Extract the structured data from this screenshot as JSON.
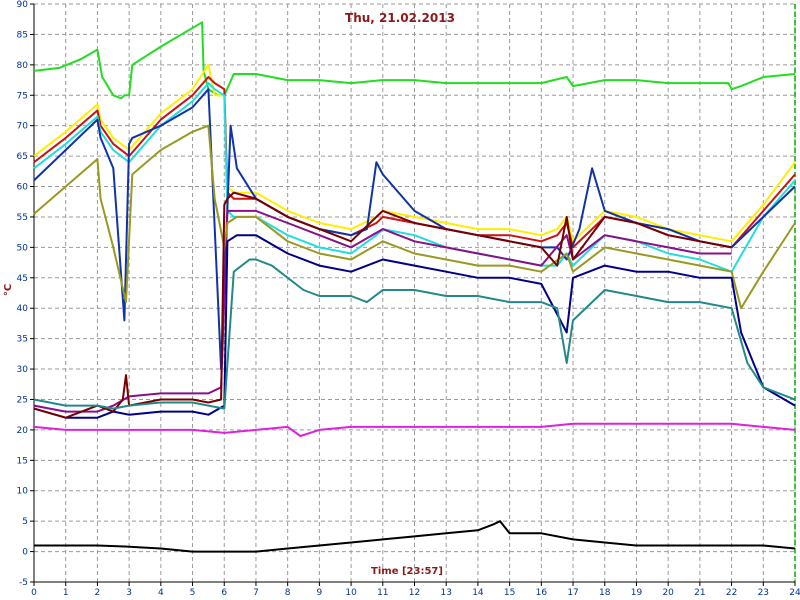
{
  "chart_data": {
    "type": "line",
    "title": "Thu, 21.02.2013",
    "xlabel": "Time [23:57]",
    "ylabel": "°C",
    "xlim": [
      0,
      24
    ],
    "ylim": [
      -5,
      90
    ],
    "x_ticks": [
      "0",
      "1",
      "2",
      "3",
      "4",
      "5",
      "6",
      "7",
      "8",
      "9",
      "10",
      "11",
      "12",
      "13",
      "14",
      "15",
      "16",
      "17",
      "18",
      "19",
      "20",
      "21",
      "22",
      "23",
      "24"
    ],
    "y_ticks": [
      "-5",
      "0",
      "5",
      "10",
      "15",
      "20",
      "25",
      "30",
      "35",
      "40",
      "45",
      "50",
      "55",
      "60",
      "65",
      "70",
      "75",
      "80",
      "85",
      "90"
    ],
    "grid": true,
    "legend": "none",
    "series": [
      {
        "color": "#22dd22",
        "x": [
          0,
          0.8,
          1.5,
          2,
          2.15,
          2.5,
          2.75,
          2.85,
          3,
          3.1,
          4,
          5.3,
          5.35,
          5.5,
          5.8,
          6,
          6.3,
          7,
          8,
          9,
          10,
          11,
          12,
          13,
          14,
          15,
          16,
          16.8,
          17,
          18,
          19,
          20,
          21,
          21.9,
          22,
          22.3,
          23,
          24
        ],
        "y": [
          79,
          79.5,
          81,
          82.5,
          78,
          75,
          74.5,
          75,
          75,
          80,
          83,
          87,
          79,
          76,
          75,
          75,
          78.5,
          78.5,
          77.5,
          77.5,
          77,
          77.5,
          77.5,
          77,
          77,
          77,
          77,
          78,
          76.5,
          77.5,
          77.5,
          77,
          77,
          77,
          76,
          76.5,
          78,
          78.5
        ]
      },
      {
        "color": "#ffee00",
        "x": [
          0,
          1,
          2,
          2.1,
          2.5,
          3,
          4,
          5,
          5.5,
          5.7,
          6,
          6.1,
          6.3,
          7,
          8,
          9,
          10,
          10.8,
          11,
          12,
          13,
          14,
          15,
          16,
          16.5,
          16.8,
          17,
          18,
          19,
          20,
          21,
          22,
          23,
          24
        ],
        "y": [
          65,
          69,
          73.5,
          71,
          68,
          66,
          72,
          76,
          80,
          75,
          75,
          60,
          59,
          59,
          56,
          54,
          53,
          55,
          56,
          55,
          54,
          53,
          53,
          52,
          53,
          55,
          51,
          56,
          55,
          53,
          52,
          51,
          57,
          64
        ]
      },
      {
        "color": "#cc1111",
        "x": [
          0,
          1,
          2,
          2.1,
          2.5,
          3,
          4,
          5,
          5.5,
          5.7,
          6,
          6.1,
          6.3,
          7,
          8,
          9,
          10,
          10.8,
          11,
          12,
          13,
          14,
          15,
          16,
          16.5,
          16.8,
          17,
          18,
          19,
          20,
          21,
          22,
          23,
          24
        ],
        "y": [
          64,
          68,
          72.5,
          70,
          67,
          65,
          71,
          75,
          78,
          77,
          76,
          59,
          58,
          58,
          55,
          53,
          52,
          54,
          55,
          54,
          53,
          52,
          52,
          51,
          52,
          54,
          50,
          55,
          54,
          52,
          51,
          50,
          56,
          62
        ]
      },
      {
        "color": "#22dddd",
        "x": [
          0,
          1,
          2,
          2.1,
          2.5,
          3,
          4,
          5,
          5.5,
          5.7,
          6,
          6.1,
          6.3,
          7,
          8,
          9,
          10,
          10.8,
          11,
          12,
          13,
          14,
          15,
          16,
          16.5,
          16.8,
          17,
          18,
          19,
          20,
          21,
          22,
          23,
          24
        ],
        "y": [
          63,
          67,
          71.5,
          69,
          66,
          64,
          70,
          74,
          77,
          76,
          75,
          56,
          55,
          55,
          52,
          50,
          49,
          52,
          53,
          52,
          50,
          49,
          48,
          47,
          47,
          49,
          47,
          52,
          51,
          49,
          48,
          46,
          55,
          61
        ]
      },
      {
        "color": "#1133aa",
        "x": [
          0,
          1,
          2,
          2.1,
          2.5,
          2.85,
          3,
          3.1,
          4,
          5,
          5.5,
          5.9,
          6.2,
          6.4,
          7,
          8,
          9,
          10,
          10.5,
          10.8,
          11,
          12,
          13,
          14,
          15,
          16,
          16.5,
          16.8,
          17.2,
          17.6,
          18,
          19,
          20,
          21,
          22,
          23,
          24
        ],
        "y": [
          61,
          66,
          71,
          68,
          63,
          38,
          67,
          68,
          70,
          73,
          76,
          30,
          70,
          63,
          58,
          55,
          53,
          52,
          53,
          64,
          62,
          56,
          53,
          52,
          51,
          50,
          50,
          48,
          53,
          63,
          56,
          54,
          53,
          51,
          50,
          55,
          60
        ]
      },
      {
        "color": "#881188",
        "x": [
          0,
          1,
          2,
          2.5,
          3,
          4,
          5,
          5.5,
          5.9,
          6.1,
          6.4,
          7,
          8,
          9,
          10,
          11,
          12,
          13,
          14,
          15,
          16,
          16.8,
          17,
          18,
          19,
          20,
          21,
          22
        ],
        "y": [
          24,
          23,
          23,
          24,
          25.5,
          26,
          26,
          26,
          27,
          56,
          56,
          56,
          54,
          52,
          50,
          53,
          51,
          50,
          49,
          48,
          47,
          52,
          48,
          52,
          51,
          50,
          49,
          49
        ]
      },
      {
        "color": "#999922",
        "x": [
          0,
          1,
          2,
          2.1,
          2.5,
          2.9,
          3.1,
          4,
          5,
          5.5,
          5.7,
          6,
          6.1,
          6.4,
          7,
          8,
          9,
          10,
          11,
          12,
          13,
          14,
          15,
          16,
          16.8,
          17,
          18,
          19,
          20,
          21,
          22,
          22.3,
          23,
          24
        ],
        "y": [
          55.5,
          60,
          64.5,
          58,
          50,
          41,
          62,
          66,
          69,
          70,
          58,
          50,
          54,
          55,
          55,
          51,
          49,
          48,
          51,
          49,
          48,
          47,
          47,
          46,
          49,
          46,
          50,
          49,
          48,
          47,
          46,
          40,
          46,
          54
        ]
      },
      {
        "color": "#000088",
        "x": [
          0,
          1,
          2,
          2.5,
          3,
          4,
          5,
          5.5,
          6,
          6.1,
          6.4,
          7,
          8,
          9,
          10,
          11,
          12,
          13,
          14,
          15,
          16,
          16.8,
          17,
          18,
          19,
          20,
          21,
          22,
          22.3,
          23,
          24
        ],
        "y": [
          23.5,
          22,
          22,
          23,
          22.5,
          23,
          23,
          22.5,
          24,
          51,
          52,
          52,
          49,
          47,
          46,
          48,
          47,
          46,
          45,
          45,
          44,
          36,
          45,
          47,
          46,
          46,
          45,
          45,
          36,
          27,
          24
        ]
      },
      {
        "color": "#770000",
        "x": [
          0,
          1,
          2,
          2.5,
          2.8,
          2.9,
          3,
          4,
          5,
          5.5,
          5.9,
          6,
          6.1,
          6.3,
          7,
          8,
          9,
          10,
          10.8,
          11,
          12,
          13,
          14,
          15,
          16,
          16.5,
          16.8,
          17,
          18,
          19,
          20,
          21,
          22
        ],
        "y": [
          23.5,
          22,
          24,
          23,
          25,
          29,
          24,
          25,
          25,
          24.5,
          25,
          57,
          58,
          59,
          58,
          55,
          53,
          51,
          55,
          56,
          54,
          53,
          52,
          51,
          50,
          47,
          55,
          48,
          55,
          54,
          52,
          51,
          50
        ]
      },
      {
        "color": "#228888",
        "x": [
          0,
          1,
          2,
          2.5,
          3,
          4,
          5,
          5.5,
          6,
          6.3,
          6.8,
          7,
          7.5,
          8,
          8.5,
          9,
          10,
          10.5,
          11,
          12,
          13,
          14,
          15,
          16,
          16.5,
          16.8,
          17,
          18,
          19,
          20,
          21,
          22,
          22.5,
          23,
          24
        ],
        "y": [
          25,
          24,
          24,
          23.5,
          24,
          24.5,
          24.5,
          24,
          23.5,
          46,
          48,
          48,
          47,
          45,
          43,
          42,
          42,
          41,
          43,
          43,
          42,
          42,
          41,
          41,
          40,
          31,
          38,
          43,
          42,
          41,
          41,
          40,
          31,
          27,
          25
        ]
      },
      {
        "color": "#dd22dd",
        "x": [
          0,
          1,
          2,
          3,
          4,
          5,
          6,
          7,
          8,
          8.4,
          9,
          10,
          11,
          12,
          13,
          14,
          15,
          16,
          17,
          18,
          19,
          20,
          21,
          22,
          23,
          24
        ],
        "y": [
          20.5,
          20,
          20,
          20,
          20,
          20,
          19.5,
          20,
          20.5,
          19,
          20,
          20.5,
          20.5,
          20.5,
          20.5,
          20.5,
          20.5,
          20.5,
          21,
          21,
          21,
          21,
          21,
          21,
          20.5,
          20
        ]
      },
      {
        "color": "#000000",
        "x": [
          0,
          1,
          2,
          3,
          4,
          5,
          6,
          7,
          8,
          9,
          10,
          11,
          12,
          13,
          14,
          14.5,
          14.7,
          15,
          16,
          17,
          18,
          19,
          20,
          21,
          22,
          23,
          24
        ],
        "y": [
          1,
          1,
          1,
          0.8,
          0.5,
          0,
          0,
          0,
          0.5,
          1,
          1.5,
          2,
          2.5,
          3,
          3.5,
          4.5,
          5,
          3,
          3,
          2,
          1.5,
          1,
          1,
          1,
          1,
          1,
          0.5
        ]
      }
    ]
  }
}
